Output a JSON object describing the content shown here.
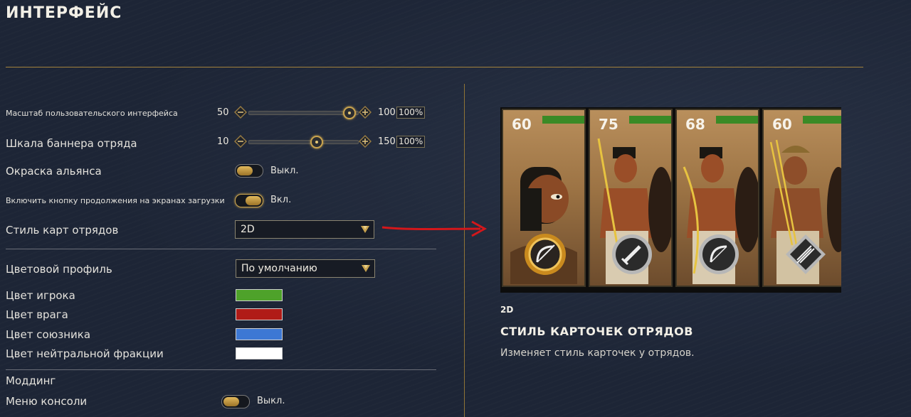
{
  "page": {
    "title": "ИНТЕРФЕЙС"
  },
  "settings": {
    "ui_scale": {
      "label": "Масштаб пользовательского интерфейса",
      "min": "50",
      "max": "100",
      "value": "100%",
      "fraction": 1.0
    },
    "banner_scale": {
      "label": "Шкала баннера отряда",
      "min": "10",
      "max": "150",
      "value": "100%",
      "fraction": 0.64
    },
    "alliance_coloring": {
      "label": "Окраска альянса",
      "state": "Выкл."
    },
    "continue_button": {
      "label": "Включить кнопку продолжения на экранах загрузки",
      "state": "Вкл."
    },
    "card_style": {
      "label": "Стиль карт отрядов",
      "value": "2D"
    },
    "color_profile": {
      "label": "Цветовой профиль",
      "value": "По умолчанию"
    },
    "player_color": {
      "label": "Цвет игрока",
      "color": "#4ea22a"
    },
    "enemy_color": {
      "label": "Цвет врага",
      "color": "#b01b17"
    },
    "ally_color": {
      "label": "Цвет союзника",
      "color": "#3d78d4"
    },
    "neutral_color": {
      "label": "Цвет нейтральной фракции",
      "color": "#ffffff"
    },
    "modding": {
      "label": "Моддинг"
    },
    "console_menu": {
      "label": "Меню консоли",
      "state": "Выкл."
    }
  },
  "preview": {
    "cards": [
      {
        "number": "60",
        "emblem": "bow-icon"
      },
      {
        "number": "75",
        "emblem": "sword-icon"
      },
      {
        "number": "68",
        "emblem": "bow-icon"
      },
      {
        "number": "60",
        "emblem": "javelins-icon"
      }
    ],
    "subtitle": "2D",
    "title": "СТИЛЬ КАРТОЧЕК ОТРЯДОВ",
    "description": "Изменяет стиль карточек у отрядов."
  },
  "colors": {
    "accent": "#c9a34e",
    "health": "#3a8a26"
  }
}
